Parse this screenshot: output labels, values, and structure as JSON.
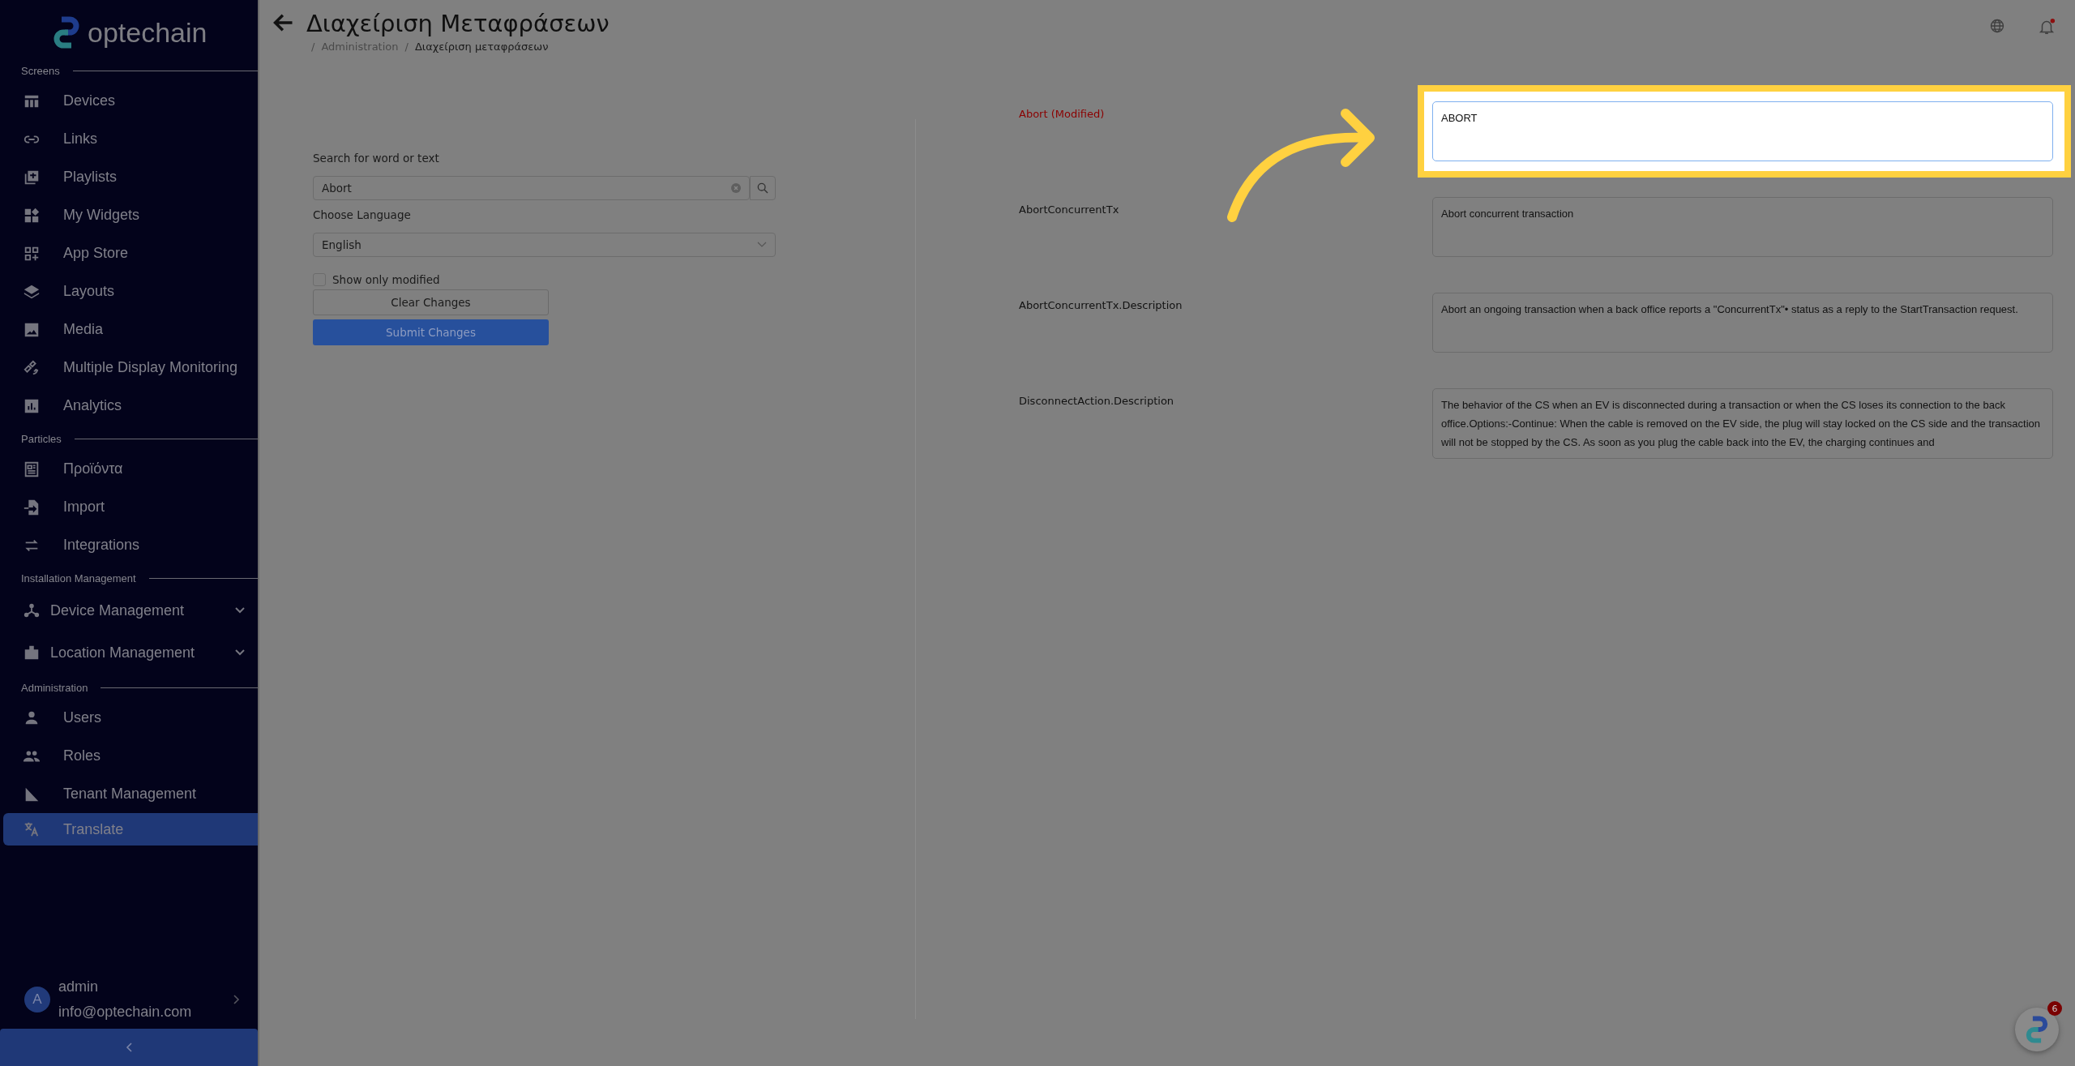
{
  "logo": {
    "text": "optechain"
  },
  "sidebar": {
    "sections": [
      {
        "title": "Screens",
        "items": [
          {
            "label": "Devices",
            "selected": false,
            "expandable": false
          },
          {
            "label": "Links",
            "selected": false,
            "expandable": false
          },
          {
            "label": "Playlists",
            "selected": false,
            "expandable": false
          },
          {
            "label": "My Widgets",
            "selected": false,
            "expandable": false
          },
          {
            "label": "App Store",
            "selected": false,
            "expandable": false
          },
          {
            "label": "Layouts",
            "selected": false,
            "expandable": false
          },
          {
            "label": "Media",
            "selected": false,
            "expandable": false
          },
          {
            "label": "Multiple Display Monitoring",
            "selected": false,
            "expandable": false
          },
          {
            "label": "Analytics",
            "selected": false,
            "expandable": false
          }
        ]
      },
      {
        "title": "Particles",
        "items": [
          {
            "label": "Προϊόντα",
            "selected": false,
            "expandable": false
          },
          {
            "label": "Import",
            "selected": false,
            "expandable": false
          },
          {
            "label": "Integrations",
            "selected": false,
            "expandable": false
          }
        ]
      },
      {
        "title": "Installation Management",
        "items": [
          {
            "label": "Device Management",
            "selected": false,
            "expandable": true
          },
          {
            "label": "Location Management",
            "selected": false,
            "expandable": true
          }
        ]
      },
      {
        "title": "Administration",
        "items": [
          {
            "label": "Users",
            "selected": false,
            "expandable": false
          },
          {
            "label": "Roles",
            "selected": false,
            "expandable": false
          },
          {
            "label": "Tenant Management",
            "selected": false,
            "expandable": false
          },
          {
            "label": "Translate",
            "selected": true,
            "expandable": false
          }
        ]
      }
    ],
    "user": {
      "initial": "A",
      "name": "admin",
      "email": "info@optechain.com"
    }
  },
  "header": {
    "title": "Διαχείριση Μεταφράσεων",
    "breadcrumb": {
      "separator": "/",
      "items": [
        "Administration",
        "Διαχείριση μεταφράσεων"
      ]
    },
    "notification_dot": true
  },
  "form": {
    "search_label": "Search for word or text",
    "search_value": "Abort",
    "language_label": "Choose Language",
    "language_value": "English",
    "show_only_modified": {
      "label": "Show only modified",
      "checked": false
    },
    "buttons": [
      {
        "label": "Clear Changes",
        "kind": "outline"
      },
      {
        "label": "Submit Changes",
        "kind": "primary"
      }
    ]
  },
  "translations": [
    {
      "key": "Abort (Modified)",
      "modified": true,
      "highlighted": true,
      "value": "ABORT"
    },
    {
      "key": "AbortConcurrentTx",
      "modified": false,
      "highlighted": false,
      "value": "Abort concurrent transaction"
    },
    {
      "key": "AbortConcurrentTx.Description",
      "modified": false,
      "highlighted": false,
      "value": "Abort an ongoing transaction when a back office reports a \"ConcurrentTx\"• status as a reply to the StartTransaction request."
    },
    {
      "key": "DisconnectAction.Description",
      "modified": false,
      "highlighted": false,
      "value": "The behavior of the CS when an EV is disconnected during a transaction or when the CS loses its connection to the back office.Options:-Continue: When the cable is removed on the EV side, the plug will stay locked on the CS side and the transaction will not be stopped by the CS. As soon as you plug the cable back into the EV, the charging continues and"
    }
  ],
  "chat_badge": {
    "count": "6"
  }
}
